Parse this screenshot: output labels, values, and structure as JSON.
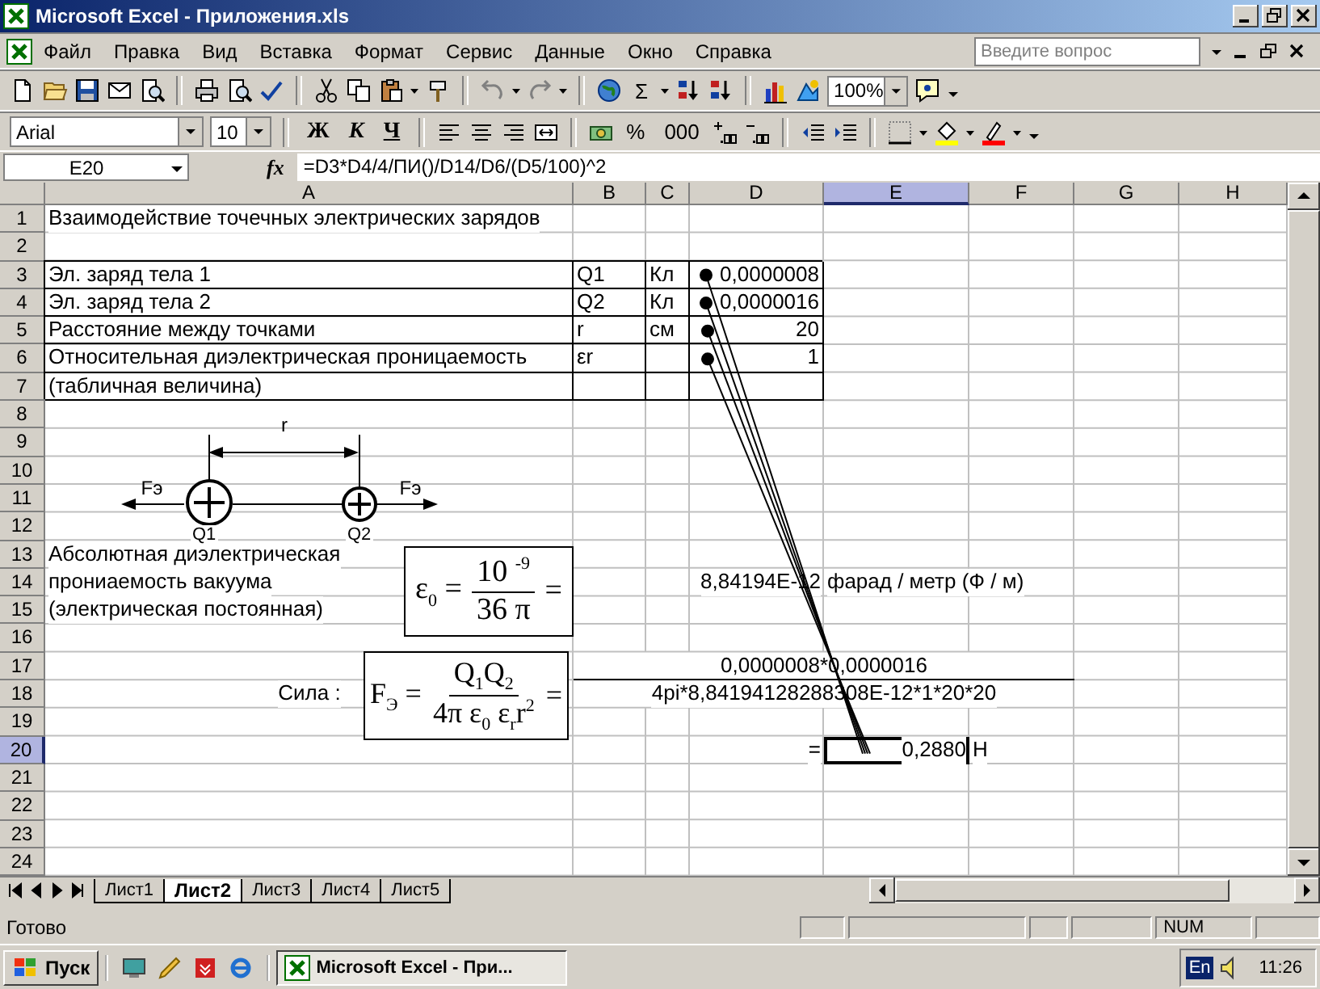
{
  "window": {
    "title": "Microsoft Excel - Приложения.xls"
  },
  "menu": [
    {
      "label": "Файл"
    },
    {
      "label": "Правка"
    },
    {
      "label": "Вид"
    },
    {
      "label": "Вставка"
    },
    {
      "label": "Формат"
    },
    {
      "label": "Сервис"
    },
    {
      "label": "Данные"
    },
    {
      "label": "Окно"
    },
    {
      "label": "Справка"
    }
  ],
  "help_search": {
    "placeholder": "Введите вопрос"
  },
  "standard_toolbar": {
    "autosum": "Σ",
    "zoom": "100%"
  },
  "formatting_toolbar": {
    "font": "Arial",
    "size": "10",
    "bold": "Ж",
    "italic": "К",
    "underline": "Ч",
    "percent": "%",
    "thousands": "000"
  },
  "formula_bar": {
    "name_box": "E20",
    "function_label": "fx",
    "formula": "=D3*D4/4/ПИ()/D14/D6/(D5/100)^2"
  },
  "sheet": {
    "columns": [
      {
        "label": "A",
        "selected": false
      },
      {
        "label": "B",
        "selected": false
      },
      {
        "label": "C",
        "selected": false
      },
      {
        "label": "D",
        "selected": false
      },
      {
        "label": "E",
        "selected": true
      },
      {
        "label": "F",
        "selected": false
      },
      {
        "label": "G",
        "selected": false
      },
      {
        "label": "H",
        "selected": false
      }
    ],
    "rows": [
      {
        "number": "1",
        "selected": false,
        "cells": {
          "A": {
            "text": "Взаимодействие точечных электрических зарядов"
          }
        }
      },
      {
        "number": "2",
        "selected": false,
        "cells": {}
      },
      {
        "number": "3",
        "selected": false,
        "cells": {
          "A": {
            "text": "Эл. заряд тела 1",
            "boxed": true
          },
          "B": {
            "text": "Q1",
            "boxed": true
          },
          "C": {
            "text": "Кл",
            "boxed": true
          },
          "D": {
            "text": "0,0000008",
            "boxed": true,
            "align_right": true
          }
        }
      },
      {
        "number": "4",
        "selected": false,
        "cells": {
          "A": {
            "text": "Эл. заряд тела 2",
            "boxed": true
          },
          "B": {
            "text": "Q2",
            "boxed": true
          },
          "C": {
            "text": "Кл",
            "boxed": true
          },
          "D": {
            "text": "0,0000016",
            "boxed": true,
            "align_right": true
          }
        }
      },
      {
        "number": "5",
        "selected": false,
        "cells": {
          "A": {
            "text": "Расстояние между точками",
            "boxed": true
          },
          "B": {
            "text": "r",
            "boxed": true
          },
          "C": {
            "text": "см",
            "boxed": true
          },
          "D": {
            "text": "20",
            "boxed": true,
            "align_right": true
          }
        }
      },
      {
        "number": "6",
        "selected": false,
        "cells": {
          "A": {
            "text": "Относительная диэлектрическая проницаемость",
            "boxed": true
          },
          "B": {
            "text": "εr",
            "boxed": true
          },
          "D": {
            "text": "1",
            "boxed": true,
            "align_right": true
          }
        }
      },
      {
        "number": "7",
        "selected": false,
        "cells": {
          "A": {
            "text": "(табличная величина)",
            "boxed": true
          },
          "B": {
            "boxed": true
          },
          "C": {
            "boxed": true
          },
          "D": {
            "boxed": true
          }
        }
      },
      {
        "number": "8",
        "selected": false,
        "cells": {}
      },
      {
        "number": "9",
        "selected": false,
        "cells": {}
      },
      {
        "number": "10",
        "selected": false,
        "cells": {}
      },
      {
        "number": "11",
        "selected": false,
        "cells": {}
      },
      {
        "number": "12",
        "selected": false,
        "cells": {}
      },
      {
        "number": "13",
        "selected": false,
        "cells": {
          "A": {
            "text": "Абсолютная диэлектрическая"
          }
        }
      },
      {
        "number": "14",
        "selected": false,
        "cells": {
          "A": {
            "text": "прониаемость вакуума"
          },
          "D": {
            "text": "8,84194E-12",
            "align_right": true
          },
          "E": {
            "text": "фарад / метр (Ф / м)"
          }
        }
      },
      {
        "number": "15",
        "selected": false,
        "cells": {
          "A": {
            "text": "(электрическая постоянная)"
          }
        }
      },
      {
        "number": "16",
        "selected": false,
        "cells": {}
      },
      {
        "number": "17",
        "selected": false,
        "cells": {
          "B:F": {
            "text": "0,0000008*0,0000016",
            "centered": true,
            "rule_below": true
          }
        }
      },
      {
        "number": "18",
        "selected": false,
        "cells": {
          "A": {
            "text": "Сила :",
            "centered": true
          },
          "B:F": {
            "text": "4pi*8,84194128288308E-12*1*20*20",
            "centered": true
          }
        }
      },
      {
        "number": "19",
        "selected": false,
        "cells": {}
      },
      {
        "number": "20",
        "selected": true,
        "cells": {
          "D": {
            "text": "=",
            "align_right": true
          },
          "E": {
            "text": "0,2880",
            "align_right": true
          },
          "F": {
            "text": "Н"
          }
        }
      },
      {
        "number": "21",
        "selected": false,
        "cells": {}
      },
      {
        "number": "22",
        "selected": false,
        "cells": {}
      },
      {
        "number": "23",
        "selected": false,
        "cells": {}
      },
      {
        "number": "24",
        "selected": false,
        "cells": {}
      }
    ],
    "trace_precedents": true,
    "diagram": {
      "distance_label": "r",
      "force_labels": [
        "Fэ",
        "Fэ"
      ],
      "charges": [
        "Q1",
        "Q2"
      ]
    },
    "equations": [
      {
        "lhs": "ε$_{0}$ =",
        "numerator": "10 $^{-9}$",
        "denominator": "36 π",
        "rhs": "="
      },
      {
        "lhs": "F$_{Э}$ =",
        "numerator": "Q$_{1}$Q$_{2}$",
        "denominator": "4π ε$_{0}$ ε$_{r}$r$^{2}$",
        "rhs": "="
      }
    ]
  },
  "sheet_tabs": [
    {
      "label": "Лист1",
      "selected": false
    },
    {
      "label": "Лист2",
      "selected": true
    },
    {
      "label": "Лист3",
      "selected": false
    },
    {
      "label": "Лист4",
      "selected": false
    },
    {
      "label": "Лист5",
      "selected": false
    }
  ],
  "status_bar": {
    "text": "Готово",
    "num": "NUM"
  },
  "taskbar": {
    "start": "Пуск",
    "tasks": [
      {
        "label": "Microsoft Excel - При...",
        "selected": true
      }
    ],
    "language": "En",
    "clock": "11:26"
  }
}
